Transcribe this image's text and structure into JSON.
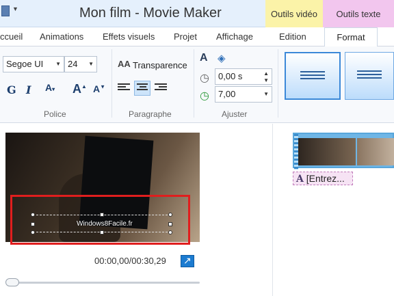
{
  "window": {
    "title": "Mon film - Movie Maker",
    "context_tabs": [
      "Outils vidéo",
      "Outils texte"
    ]
  },
  "tabs": [
    "ccueil",
    "Animations",
    "Effets visuels",
    "Projet",
    "Affichage",
    "Edition",
    "Format"
  ],
  "ribbon": {
    "police": {
      "font_family": "Segoe UI",
      "font_size": "24",
      "label": "Police"
    },
    "paragraphe": {
      "transparency_label": "Transparence",
      "label": "Paragraphe"
    },
    "ajuster": {
      "start_time": "0,00 s",
      "duration": "7,00",
      "label": "Ajuster"
    }
  },
  "preview": {
    "overlay_text": "Windows8Facile.fr",
    "timecode": "00:00,00/00:30,29"
  },
  "storyboard": {
    "caption_placeholder": "[Entrez..."
  },
  "colors": {
    "ctx_video": "#fbf3a8",
    "ctx_text": "#f2c6ee",
    "highlight_red": "#e01e1e"
  }
}
